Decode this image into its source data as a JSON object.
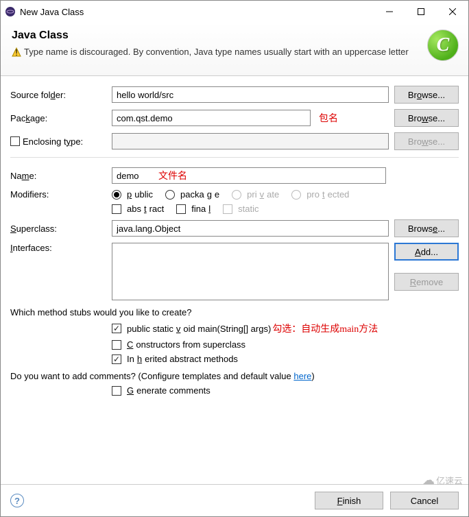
{
  "window": {
    "title": "New Java Class",
    "heading": "Java Class",
    "warning": "Type name is discouraged. By convention, Java type names usually start with an uppercase letter"
  },
  "labels": {
    "source_folder": "Source folder:",
    "package": "Package:",
    "enclosing_type": "Enclosing type:",
    "name": "Name:",
    "modifiers": "Modifiers:",
    "superclass": "Superclass:",
    "interfaces": "Interfaces:",
    "stubs_question": "Which method stubs would you like to create?",
    "comments_question": "Do you want to add comments? (Configure templates and default value ",
    "here": "here",
    "close_paren": ")"
  },
  "values": {
    "source_folder": "hello world/src",
    "package": "com.qst.demo",
    "enclosing_type": "",
    "name": "demo",
    "superclass": "java.lang.Object"
  },
  "modifiers": {
    "public": "public",
    "package": "package",
    "private": "private",
    "protected": "protected",
    "abstract": "abstract",
    "final": "final",
    "static": "static"
  },
  "stubs": {
    "main": "public static void main(String[] args)",
    "constructors": "Constructors from superclass",
    "inherited": "Inherited abstract methods"
  },
  "generate_comments": "Generate comments",
  "buttons": {
    "browse": "Browse...",
    "add": "Add...",
    "remove": "Remove",
    "finish": "Finish",
    "cancel": "Cancel"
  },
  "annotations": {
    "package": "包名",
    "filename": "文件名",
    "main_hint": "勾选：自动生成main方法"
  },
  "watermark": "亿速云"
}
